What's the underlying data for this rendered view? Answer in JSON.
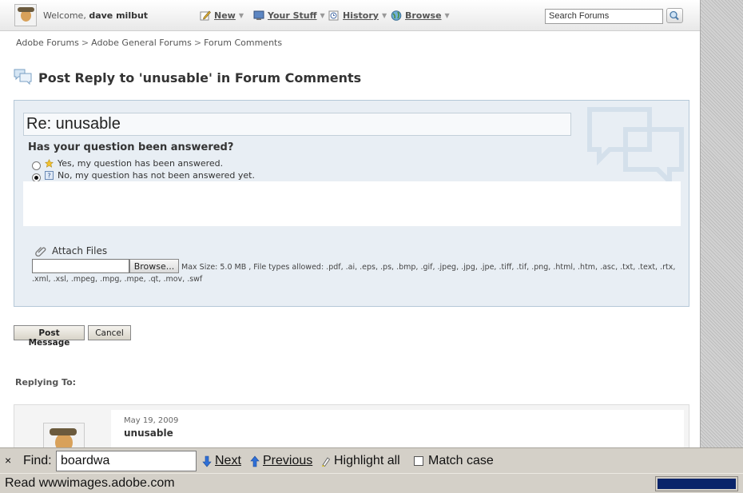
{
  "header": {
    "welcome_prefix": "Welcome,",
    "username": "dave milbut",
    "nav": [
      {
        "label": "New",
        "icon": "pencil-icon"
      },
      {
        "label": "Your Stuff",
        "icon": "monitor-icon"
      },
      {
        "label": "History",
        "icon": "clock-icon"
      },
      {
        "label": "Browse",
        "icon": "globe-icon"
      }
    ],
    "search_value": "Search Forums"
  },
  "breadcrumb": [
    "Adobe Forums",
    "Adobe General Forums",
    "Forum Comments"
  ],
  "breadcrumb_sep": ">",
  "page_title": "Post Reply to 'unusable' in Forum Comments",
  "form": {
    "subject": "Re: unusable",
    "question": "Has your question been answered?",
    "options": [
      {
        "label": "Yes, my question has been answered.",
        "selected": false,
        "icon": "star-icon"
      },
      {
        "label": "No, my question has not been answered yet.",
        "selected": true,
        "icon": "question-icon"
      }
    ],
    "attach_label": "Attach Files",
    "browse_label": "Browse...",
    "file_note": "Max Size: 5.0 MB , File types allowed: .pdf, .ai, .eps, .ps, .bmp, .gif, .jpeg, .jpg, .jpe, .tiff, .tif, .png, .html, .htm, .asc, .txt, .text, .rtx, .xml, .xsl, .mpeg, .mpg, .mpe, .qt, .mov, .swf"
  },
  "actions": {
    "post_label": "Post Message",
    "cancel_label": "Cancel"
  },
  "replying": {
    "heading": "Replying To:",
    "date": "May 19, 2009",
    "subject": "unusable"
  },
  "findbar": {
    "close": "×",
    "label": "Find:",
    "query": "boardwa",
    "next": "Next",
    "previous": "Previous",
    "highlight": "Highlight all",
    "match_case": "Match case"
  },
  "status": {
    "text": "Read wwwimages.adobe.com",
    "progress": 1.0
  },
  "colors": {
    "panel_bg": "#e8eef4",
    "panel_border": "#b5c8d8",
    "progress": "#0a246a",
    "chrome": "#d4d0c8"
  }
}
